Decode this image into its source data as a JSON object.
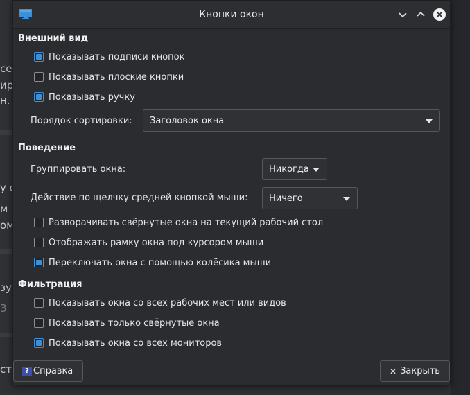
{
  "window": {
    "title": "Кнопки окон"
  },
  "background_fragments": [
    "се",
    "ир",
    "н. I",
    "у с",
    "м ",
    "ом",
    "зу",
    "З",
    "сте"
  ],
  "sections": {
    "appearance": {
      "title": "Внешний вид",
      "show_button_labels": {
        "label": "Показывать подписи кнопок",
        "checked": true
      },
      "show_flat_buttons": {
        "label": "Показывать плоские кнопки",
        "checked": false
      },
      "show_handle": {
        "label": "Показывать ручку",
        "checked": true
      },
      "sort_order": {
        "label": "Порядок сортировки:",
        "value": "Заголовок окна"
      }
    },
    "behavior": {
      "title": "Поведение",
      "group_windows": {
        "label": "Группировать окна:",
        "value": "Никогда"
      },
      "middle_click": {
        "label": "Действие по щелчку средней кнопкой мыши:",
        "value": "Ничего"
      },
      "restore_to_current": {
        "label": "Разворачивать свёрнутые окна на текущий рабочий стол",
        "checked": false
      },
      "show_frame": {
        "label": "Отображать рамку окна под курсором мыши",
        "checked": false
      },
      "mouse_wheel": {
        "label": "Переключать окна с помощью колёсика мыши",
        "checked": true
      }
    },
    "filtering": {
      "title": "Фильтрация",
      "all_workspaces": {
        "label": "Показывать окна со всех рабочих мест или видов",
        "checked": false
      },
      "only_minimized": {
        "label": "Показывать только свёрнутые окна",
        "checked": false
      },
      "all_monitors": {
        "label": "Показывать окна со всех мониторов",
        "checked": true
      }
    }
  },
  "buttons": {
    "help": "Справка",
    "close": "Закрыть"
  },
  "colors": {
    "accent": "#3d8fd6",
    "background": "#2a2c2f"
  }
}
